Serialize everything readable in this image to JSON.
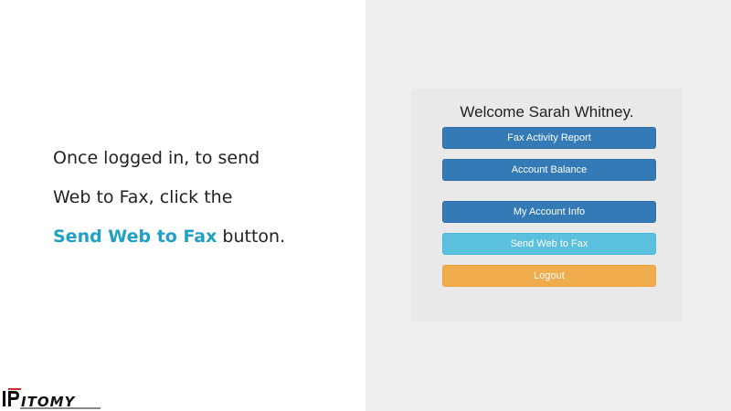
{
  "instructions": {
    "line1": "Once logged in, to send",
    "line2": "Web to Fax, click the",
    "line3_highlight": "Send Web to Fax",
    "line3_rest": " button."
  },
  "logo": {
    "text": "IPitomy"
  },
  "card": {
    "welcome": "Welcome Sarah Whitney.",
    "buttons": [
      {
        "label": "Fax Activity Report",
        "style": "primary"
      },
      {
        "label": "Account Balance",
        "style": "primary"
      },
      {
        "label": "My Account Info",
        "style": "primary"
      },
      {
        "label": "Send Web to Fax",
        "style": "info"
      },
      {
        "label": "Logout",
        "style": "warning"
      }
    ]
  },
  "colors": {
    "primary": "#337ab7",
    "info": "#5bc0de",
    "warning": "#f0ad4e",
    "highlight": "#1fa0c4"
  }
}
